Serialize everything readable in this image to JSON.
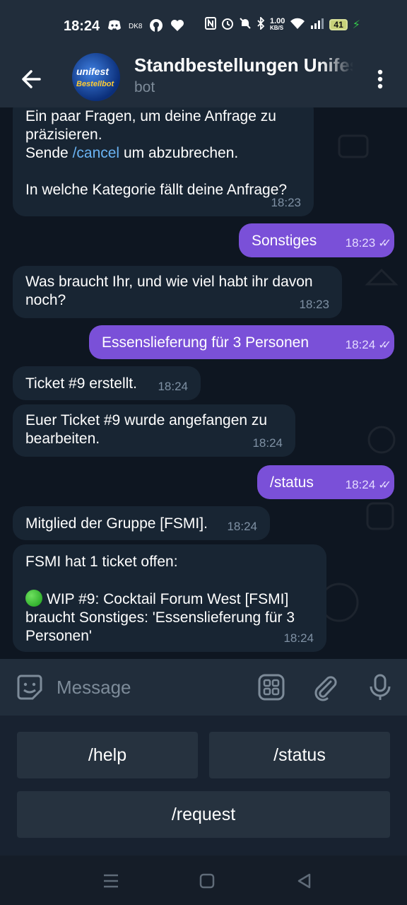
{
  "status_bar": {
    "time": "18:24",
    "left_icons": [
      "discord-icon",
      "dk8-icon",
      "github-icon",
      "heart-icon"
    ],
    "dk8_label": "DK8",
    "net_speed": "1.00",
    "net_unit": "KB/S",
    "battery": "41"
  },
  "header": {
    "title": "Standbestellungen Unifest",
    "subtitle": "bot",
    "avatar_line1": "unifest",
    "avatar_line2": "Bestellbot"
  },
  "messages": [
    {
      "dir": "in",
      "lines": [
        "Ein paar Fragen, um deine Anfrage zu",
        "präzisieren."
      ],
      "line3_pre": "Sende ",
      "line3_link": "/cancel",
      "line3_post": " um abzubrechen.",
      "line5": "In welche Kategorie fällt deine Anfrage?",
      "time": "18:23"
    },
    {
      "dir": "out",
      "text": "Sonstiges",
      "time": "18:23"
    },
    {
      "dir": "in",
      "line1": "Was braucht Ihr, und wie viel habt ihr davon",
      "line2": "noch?",
      "time": "18:23"
    },
    {
      "dir": "out",
      "text": "Essenslieferung für 3 Personen",
      "time": "18:24"
    },
    {
      "dir": "in",
      "text": "Ticket #9 erstellt.",
      "time": "18:24"
    },
    {
      "dir": "in",
      "line1": "Euer Ticket #9 wurde angefangen zu",
      "line2": "bearbeiten.",
      "time": "18:24"
    },
    {
      "dir": "out",
      "text": "/status",
      "time": "18:24"
    },
    {
      "dir": "in",
      "text": "Mitglied der Gruppe [FSMI].",
      "time": "18:24"
    },
    {
      "dir": "in",
      "line1": "FSMI hat 1 ticket offen:",
      "line3": "WIP #9: Cocktail Forum West [FSMI]",
      "line4": "braucht Sonstiges: 'Essenslieferung für 3",
      "line5": "Personen'",
      "time": "18:24"
    }
  ],
  "input": {
    "placeholder": "Message"
  },
  "keyboard": {
    "help": "/help",
    "status": "/status",
    "request": "/request"
  },
  "colors": {
    "outgoing": "#7a50d8",
    "incoming": "#182533",
    "link": "#6ab3f3",
    "background": "#0e1621"
  }
}
